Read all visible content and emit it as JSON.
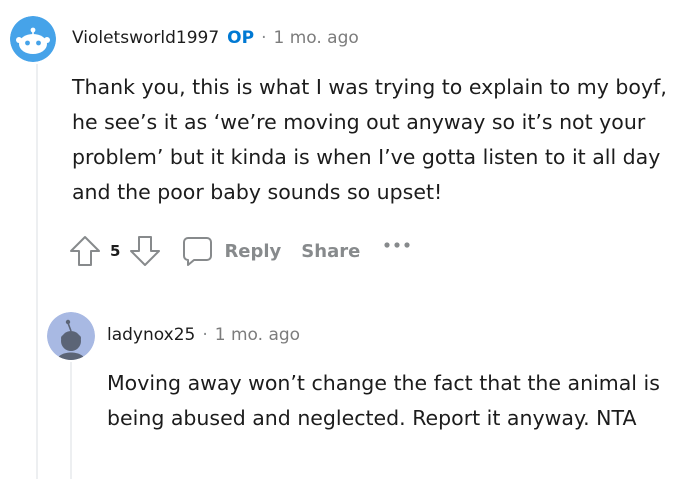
{
  "comments": [
    {
      "username": "Violetsworld1997",
      "badge": "OP",
      "separator": "·",
      "time": "1 mo. ago",
      "avatar_icon": "reddit-snoo-avatar-icon",
      "text": "Thank you, this is what I was trying to explain to my boyf, he see’s it as ‘we’re moving out anyway so it’s not your problem’ but it kinda is when I’ve gotta listen to it all day and the poor baby sounds so upset!",
      "actions": {
        "upvote_icon": "upvote-arrow-icon",
        "vote_count": "5",
        "downvote_icon": "downvote-arrow-icon",
        "reply_icon": "speech-bubble-icon",
        "reply_label": "Reply",
        "share_label": "Share",
        "more_icon": "ellipsis-icon"
      }
    },
    {
      "username": "ladynox25",
      "separator": "·",
      "time": "1 mo. ago",
      "avatar_icon": "default-snoo-avatar-icon",
      "text": "Moving away won’t change the fact that the animal is being abused and neglected. Report it anyway. NTA"
    }
  ],
  "colors": {
    "op_badge": "#0079d3",
    "meta_text": "#878a8c",
    "thread_line": "#edeff1",
    "avatar_blue": "#46a3e9",
    "avatar_default": "#a8b9e3"
  }
}
